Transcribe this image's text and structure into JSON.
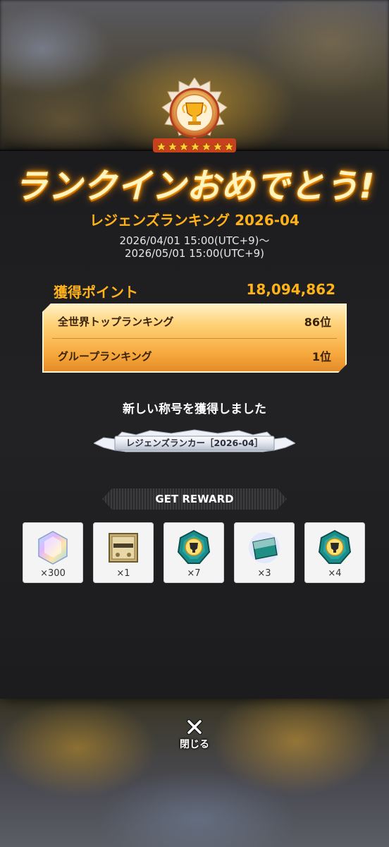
{
  "headline": "ランクインおめでとう!",
  "ranking_title": "レジェンズランキング 2026-04",
  "period": {
    "start": "2026/04/01 15:00(UTC+9)～",
    "end": "2026/05/01 15:00(UTC+9)"
  },
  "points": {
    "label": "獲得ポイント",
    "value": "18,094,862"
  },
  "rankings": [
    {
      "label": "全世界トップランキング",
      "rank": "86位"
    },
    {
      "label": "グループランキング",
      "rank": "1位"
    }
  ],
  "new_title": {
    "message": "新しい称号を獲得しました",
    "name": "レジェンズランカー［2026-04］"
  },
  "reward_header": "GET REWARD",
  "rewards": [
    {
      "icon": "rainbow-gem-icon",
      "qty": "×300"
    },
    {
      "icon": "gold-ticket-icon",
      "qty": "×1"
    },
    {
      "icon": "trophy-medal-icon",
      "qty": "×7"
    },
    {
      "icon": "crystal-card-icon",
      "qty": "×3"
    },
    {
      "icon": "trophy-medal-icon",
      "qty": "×4"
    }
  ],
  "close_label": "閉じる",
  "colors": {
    "accent_orange": "#ffb21a",
    "panel_bg": "#1c1c1e",
    "teal": "#1a8c8a"
  }
}
